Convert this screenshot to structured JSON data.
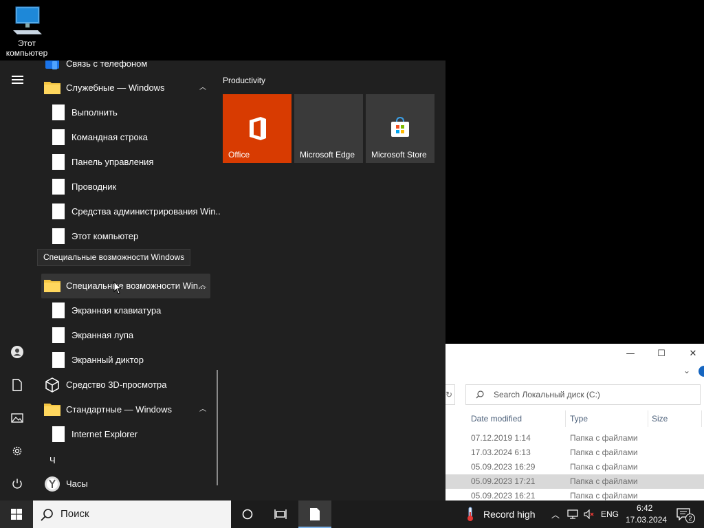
{
  "desktop": {
    "icon_label": "Этот компьютер"
  },
  "explorer": {
    "minimize": "—",
    "maximize": "☐",
    "close": "✕",
    "ribbon_chevron": "⌄",
    "refresh": "↻",
    "search_placeholder": "Search Локальный диск (C:)",
    "columns": [
      "Date modified",
      "Type",
      "Size"
    ],
    "rows": [
      {
        "date": "07.12.2019 1:14",
        "type": "Папка с файлами",
        "selected": false
      },
      {
        "date": "17.03.2024 6:13",
        "type": "Папка с файлами",
        "selected": false
      },
      {
        "date": "05.09.2023 16:29",
        "type": "Папка с файлами",
        "selected": false
      },
      {
        "date": "05.09.2023 17:21",
        "type": "Папка с файлами",
        "selected": true
      },
      {
        "date": "05.09.2023 16:21",
        "type": "Папка с файлами",
        "selected": false
      }
    ]
  },
  "start_menu": {
    "app_list": [
      {
        "label": "Связь с телефоном",
        "kind": "app"
      },
      {
        "label": "Служебные — Windows",
        "kind": "folder",
        "chevron": "︿"
      },
      {
        "label": "Выполнить",
        "kind": "doc"
      },
      {
        "label": "Командная строка",
        "kind": "doc"
      },
      {
        "label": "Панель управления",
        "kind": "doc"
      },
      {
        "label": "Проводник",
        "kind": "doc"
      },
      {
        "label": "Средства администрирования Win...",
        "kind": "doc"
      },
      {
        "label": "Этот компьютер",
        "kind": "doc"
      },
      {
        "label": "Специальные возможности Win...",
        "kind": "folder",
        "chevron": "︿"
      },
      {
        "label": "Экранная клавиатура",
        "kind": "doc"
      },
      {
        "label": "Экранная лупа",
        "kind": "doc"
      },
      {
        "label": "Экранный диктор",
        "kind": "doc"
      },
      {
        "label": "Средство 3D-просмотра",
        "kind": "app"
      },
      {
        "label": "Стандартные — Windows",
        "kind": "folder",
        "chevron": "︿"
      },
      {
        "label": "Internet Explorer",
        "kind": "doc"
      },
      {
        "label": "Часы",
        "kind": "app"
      }
    ],
    "section_letter": "Ч",
    "tooltip": "Специальные возможности Windows",
    "group_title": "Productivity",
    "tiles": [
      {
        "label": "Office",
        "bg": "#d83b01"
      },
      {
        "label": "Microsoft Edge",
        "bg": "#3a3a3a"
      },
      {
        "label": "Microsoft Store",
        "bg": "#3a3a3a"
      }
    ]
  },
  "taskbar": {
    "search_placeholder": "Поиск",
    "weather_text": "Record high",
    "tray_chevron": "︿",
    "language": "ENG",
    "time": "6:42",
    "date": "17.03.2024",
    "notification_count": "2"
  },
  "colors": {
    "start_bg": "#202020",
    "taskbar_bg": "#1c1c1c",
    "office_orange": "#d83b01",
    "accent_blue": "#7eb4ea"
  }
}
